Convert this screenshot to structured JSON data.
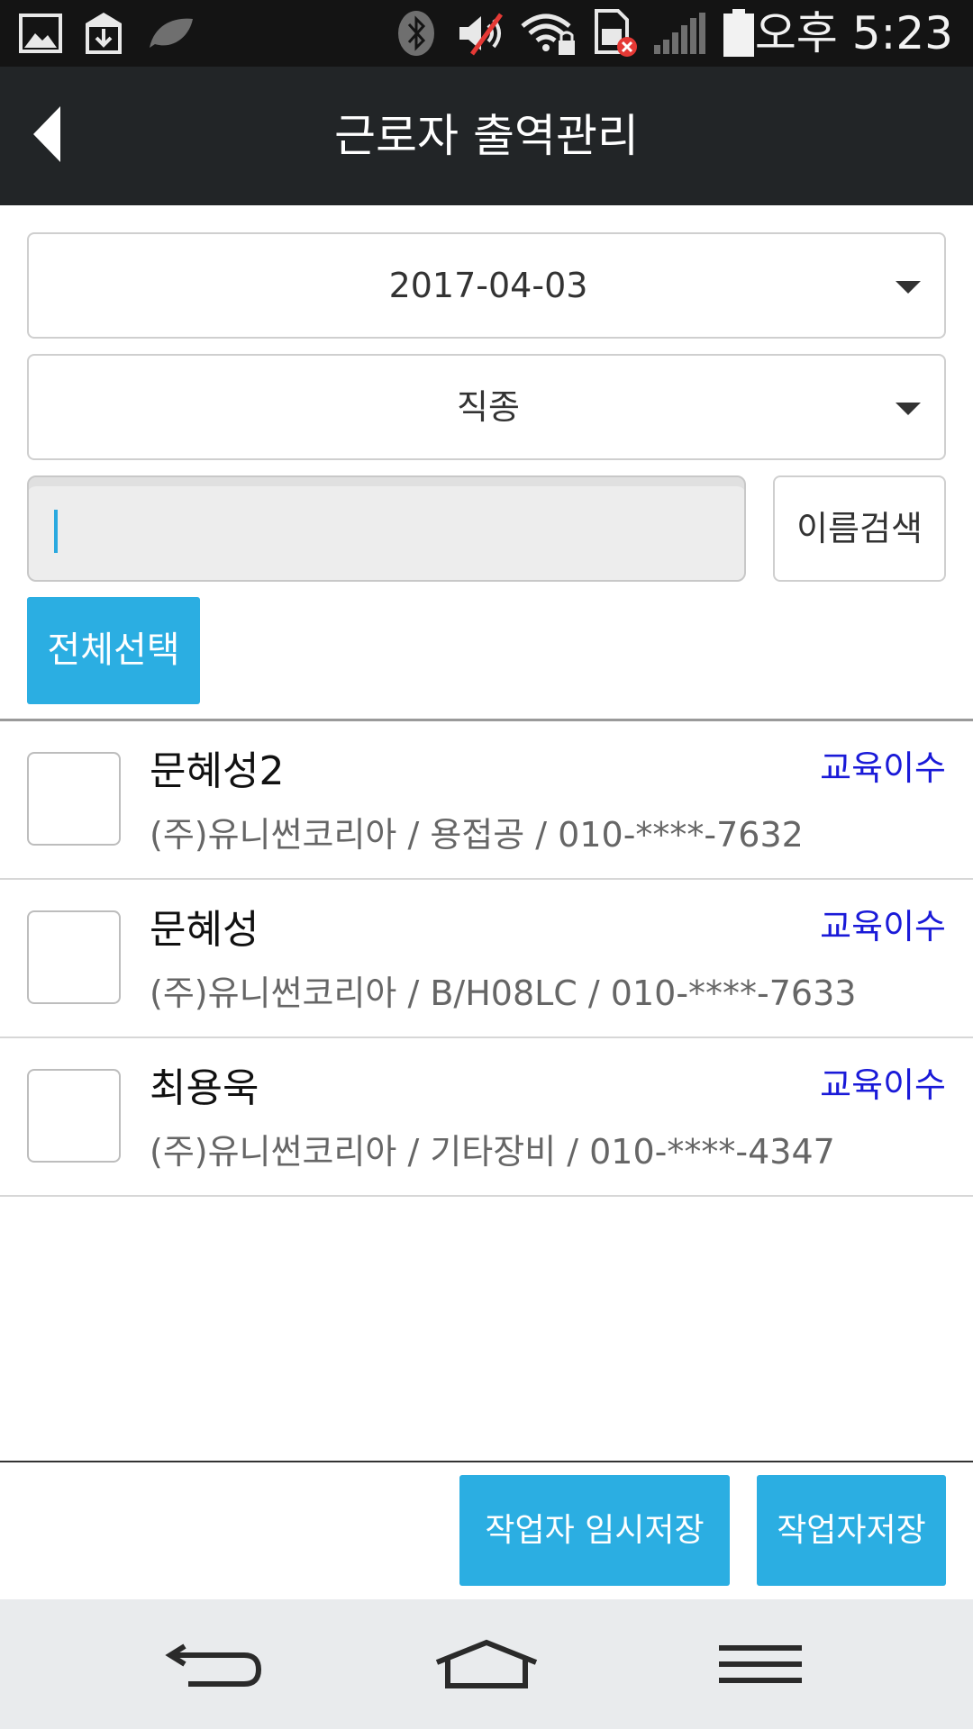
{
  "status_bar": {
    "time": "오후 5:23",
    "icons": [
      "image-icon",
      "download-icon",
      "leaf-icon",
      "bluetooth-icon",
      "mute-icon",
      "wifi-lock-icon",
      "sim-error-icon",
      "signal-icon",
      "battery-icon"
    ]
  },
  "header": {
    "title": "근로자 출역관리",
    "back_icon": "back-arrow-icon"
  },
  "filters": {
    "date_value": "2017-04-03",
    "job_type_value": "직종",
    "search_value": "",
    "search_button_label": "이름검색",
    "select_all_label": "전체선택"
  },
  "workers": [
    {
      "name": "문혜성2",
      "status": "교육이수",
      "detail": "(주)유니썬코리아 / 용접공 / 010-****-7632",
      "checked": false
    },
    {
      "name": "문혜성",
      "status": "교육이수",
      "detail": "(주)유니썬코리아 / B/H08LC / 010-****-7633",
      "checked": false
    },
    {
      "name": "최용욱",
      "status": "교육이수",
      "detail": "(주)유니썬코리아 / 기타장비 / 010-****-4347",
      "checked": false
    }
  ],
  "footer": {
    "temp_save_label": "작업자 임시저장",
    "save_label": "작업자저장"
  },
  "nav_bar": {
    "icons": [
      "nav-back-icon",
      "nav-home-icon",
      "nav-menu-icon"
    ]
  },
  "colors": {
    "accent": "#2baee2",
    "header_bg": "#222527",
    "status_link": "#1a1ad8"
  }
}
